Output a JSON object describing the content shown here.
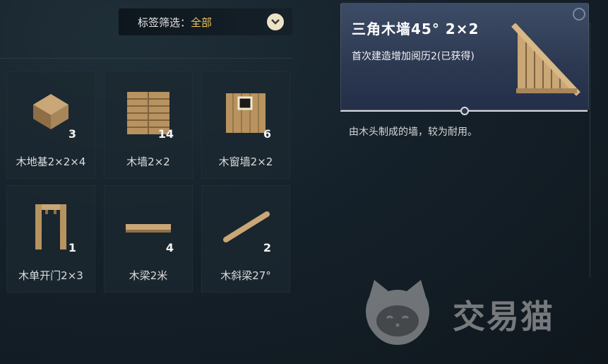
{
  "filter": {
    "label": "标签筛选：",
    "value": "全部",
    "toggle_icon": "chevron-down-icon"
  },
  "items": [
    {
      "name": "木地基2×2×4",
      "qty": "3",
      "icon": "wood-foundation-icon"
    },
    {
      "name": "木墙2×2",
      "qty": "14",
      "icon": "wood-wall-icon"
    },
    {
      "name": "木窗墙2×2",
      "qty": "6",
      "icon": "wood-window-wall-icon"
    },
    {
      "name": "木单开门2×3",
      "qty": "1",
      "icon": "wood-door-icon"
    },
    {
      "name": "木梁2米",
      "qty": "4",
      "icon": "wood-beam-icon"
    },
    {
      "name": "木斜梁27°",
      "qty": "2",
      "icon": "wood-slant-beam-icon"
    }
  ],
  "detail": {
    "title": "三角木墙45° 2×2",
    "subtitle": "首次建造增加阅历2(已获得)",
    "description": "由木头制成的墙，较为耐用。",
    "icon": "triangle-wood-wall-icon"
  },
  "watermark": {
    "text": "交易猫",
    "icon": "cat-logo-icon"
  },
  "colors": {
    "accent": "#f0c35a",
    "header_bg": "#2c3850"
  }
}
